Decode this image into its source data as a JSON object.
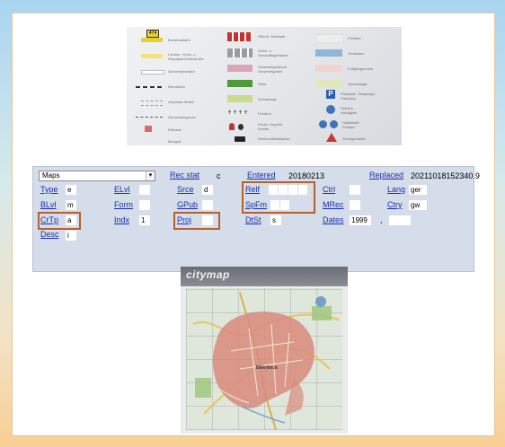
{
  "legend": {
    "badge": "474",
    "col1": [
      "Bundesstraße",
      "Landes-, Kreis- u. Hauptgemeindestraße",
      "Gemeindestraße",
      "Eisenbahn",
      "Geplante Straße",
      "Gemeindegrenze",
      "Rathaus",
      "Mongolf"
    ],
    "col2": [
      "Öffentl. Gebäude",
      "Wohn- u. Geschäftsgebäude",
      "Gewerbegebäude, Gewerbegebiet",
      "Wald",
      "Grünanlage",
      "Friedhof",
      "Kirche, Kapelle, Kloster",
      "Wohnmobilstellplatz"
    ],
    "col3": [
      "Freiland",
      "Gewässer",
      "Fußgängerzone",
      "Sportanlage",
      "Parkplatz, Tiefgarage, Parkhaus",
      "Sehens-würdigkeit",
      "Haltestelle Freibad",
      "Schulgebäude"
    ],
    "parking_letter": "P"
  },
  "record": {
    "format": "Maps",
    "rec_stat_label": "Rec stat",
    "rec_stat_value": "c",
    "entered_label": "Entered",
    "entered_value": "20180213",
    "replaced_label": "Replaced",
    "replaced_value": "20211018152340.9",
    "type_label": "Type",
    "type_value": "e",
    "elvl_label": "ELvl",
    "elvl_value": "",
    "srce_label": "Srce",
    "srce_value": "d",
    "relf_label": "Relf",
    "ctrl_label": "Ctrl",
    "ctrl_value": "",
    "lang_label": "Lang",
    "lang_value": "ger",
    "blvl_label": "BLvl",
    "blvl_value": "m",
    "form_label": "Form",
    "form_value": "",
    "gpub_label": "GPub",
    "gpub_value": "",
    "spfm_label": "SpFm",
    "mrec_label": "MRec",
    "mrec_value": "",
    "ctry_label": "Ctry",
    "ctry_value": "gw",
    "crtp_label": "CrTp",
    "crtp_value": "a",
    "indx_label": "Indx",
    "indx_value": "1",
    "proj_label": "Proj",
    "proj_value": "",
    "dtst_label": "DtSt",
    "dtst_value": "s",
    "dates_label": "Dates",
    "date1_value": "1999",
    "dates_sep": ",",
    "date2_value": "",
    "desc_label": "Desc",
    "desc_value": "i"
  },
  "citymap": {
    "brand": "citymap",
    "town_label": "Billerbeck"
  },
  "colors": {
    "link": "#1a2fb0",
    "highlight": "#b5612a",
    "form_bg": "#d4dde9"
  }
}
